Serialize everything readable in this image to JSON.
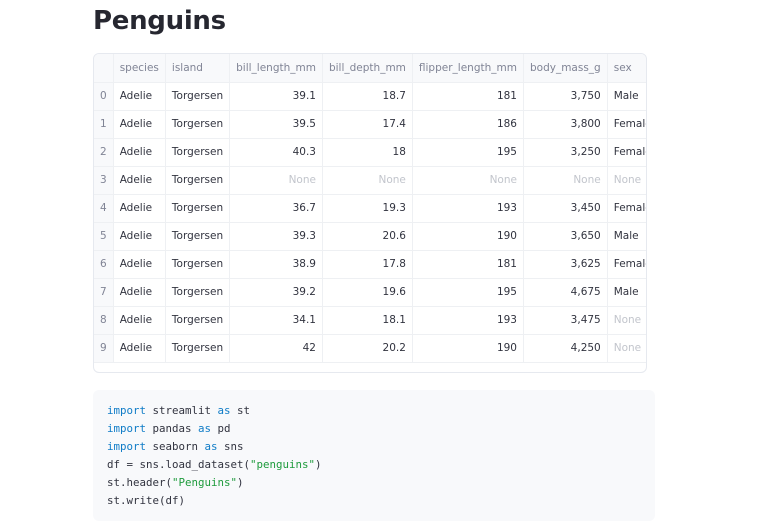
{
  "header": {
    "title": "Penguins"
  },
  "dataframe": {
    "columns": [
      "species",
      "island",
      "bill_length_mm",
      "bill_depth_mm",
      "flipper_length_mm",
      "body_mass_g",
      "sex"
    ],
    "rows": [
      {
        "index": "0",
        "cells": [
          "Adelie",
          "Torgersen",
          "39.1",
          "18.7",
          "181",
          "3,750",
          "Male"
        ]
      },
      {
        "index": "1",
        "cells": [
          "Adelie",
          "Torgersen",
          "39.5",
          "17.4",
          "186",
          "3,800",
          "Female"
        ]
      },
      {
        "index": "2",
        "cells": [
          "Adelie",
          "Torgersen",
          "40.3",
          "18",
          "195",
          "3,250",
          "Female"
        ]
      },
      {
        "index": "3",
        "cells": [
          "Adelie",
          "Torgersen",
          "None",
          "None",
          "None",
          "None",
          "None"
        ]
      },
      {
        "index": "4",
        "cells": [
          "Adelie",
          "Torgersen",
          "36.7",
          "19.3",
          "193",
          "3,450",
          "Female"
        ]
      },
      {
        "index": "5",
        "cells": [
          "Adelie",
          "Torgersen",
          "39.3",
          "20.6",
          "190",
          "3,650",
          "Male"
        ]
      },
      {
        "index": "6",
        "cells": [
          "Adelie",
          "Torgersen",
          "38.9",
          "17.8",
          "181",
          "3,625",
          "Female"
        ]
      },
      {
        "index": "7",
        "cells": [
          "Adelie",
          "Torgersen",
          "39.2",
          "19.6",
          "195",
          "4,675",
          "Male"
        ]
      },
      {
        "index": "8",
        "cells": [
          "Adelie",
          "Torgersen",
          "34.1",
          "18.1",
          "193",
          "3,475",
          "None"
        ]
      },
      {
        "index": "9",
        "cells": [
          "Adelie",
          "Torgersen",
          "42",
          "20.2",
          "190",
          "4,250",
          "None"
        ]
      }
    ]
  },
  "code": {
    "lines": [
      [
        {
          "t": "import",
          "k": "kw"
        },
        {
          "t": " streamlit "
        },
        {
          "t": "as",
          "k": "kw"
        },
        {
          "t": " st"
        }
      ],
      [
        {
          "t": "import",
          "k": "kw"
        },
        {
          "t": " pandas "
        },
        {
          "t": "as",
          "k": "kw"
        },
        {
          "t": " pd"
        }
      ],
      [
        {
          "t": "import",
          "k": "kw"
        },
        {
          "t": " seaborn "
        },
        {
          "t": "as",
          "k": "kw"
        },
        {
          "t": " sns"
        }
      ],
      [
        {
          "t": "df = sns.load_dataset("
        },
        {
          "t": "\"penguins\"",
          "k": "str"
        },
        {
          "t": ")"
        }
      ],
      [
        {
          "t": "st.header("
        },
        {
          "t": "\"Penguins\"",
          "k": "str"
        },
        {
          "t": ")"
        }
      ],
      [
        {
          "t": "st.write(df)"
        }
      ]
    ]
  },
  "colors": {
    "keyword": "#0f7cc7",
    "string": "#1e9b3c",
    "null_value": "#c2c5cc",
    "header_text": "#808495"
  }
}
